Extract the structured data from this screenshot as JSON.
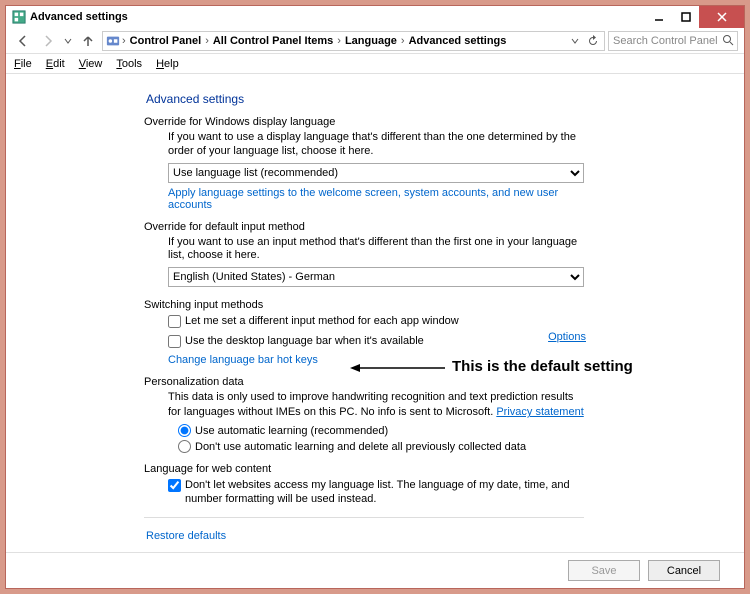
{
  "titlebar": {
    "title": "Advanced settings"
  },
  "breadcrumb": {
    "root": "Control Panel",
    "items": [
      "All Control Panel Items",
      "Language",
      "Advanced settings"
    ]
  },
  "search": {
    "placeholder": "Search Control Panel"
  },
  "menubar": [
    "File",
    "Edit",
    "View",
    "Tools",
    "Help"
  ],
  "page": {
    "title": "Advanced settings",
    "section1": {
      "header": "Override for Windows display language",
      "desc": "If you want to use a display language that's different than the one determined by the order of your language list, choose it here.",
      "combo": "Use language list (recommended)",
      "link": "Apply language settings to the welcome screen, system accounts, and new user accounts"
    },
    "section2": {
      "header": "Override for default input method",
      "desc": "If you want to use an input method that's different than the first one in your language list, choose it here.",
      "combo": "English (United States) - German"
    },
    "section3": {
      "header": "Switching input methods",
      "chk1": "Let me set a different input method for each app window",
      "chk2": "Use the desktop language bar when it's available",
      "options": "Options",
      "link": "Change language bar hot keys"
    },
    "section4": {
      "header": "Personalization data",
      "desc": "This data is only used to improve handwriting recognition and text prediction results for languages without IMEs on this PC. No info is sent to Microsoft. ",
      "privacy": "Privacy statement",
      "radio1": "Use automatic learning (recommended)",
      "radio2": "Don't use automatic learning and delete all previously collected data"
    },
    "section5": {
      "header": "Language for web content",
      "chk": "Don't let websites access my language list. The language of my date, time, and number formatting will be used instead."
    },
    "restore": "Restore defaults"
  },
  "annotation": "This is the default setting",
  "footer": {
    "save": "Save",
    "cancel": "Cancel"
  }
}
